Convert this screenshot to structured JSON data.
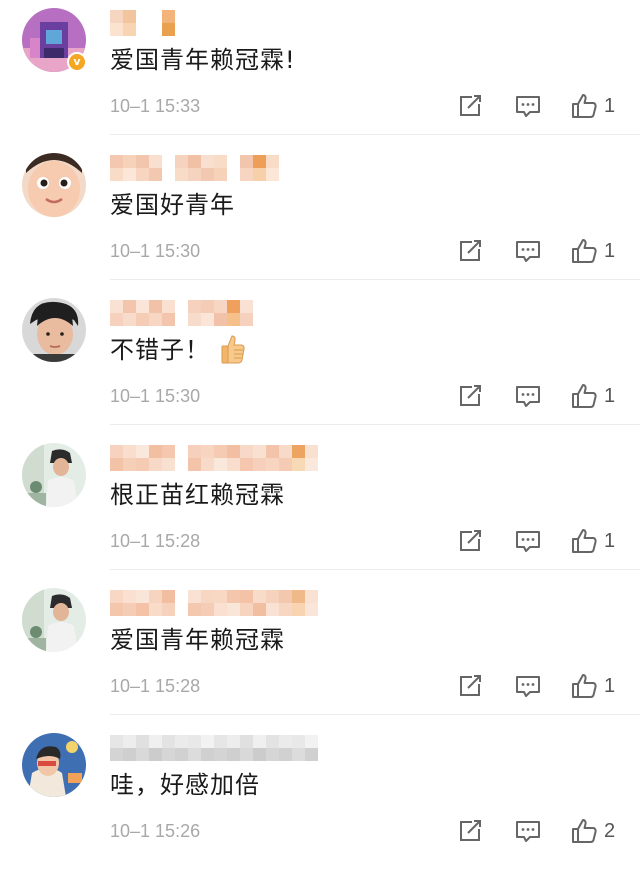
{
  "comments": [
    {
      "text": "爱国青年赖冠霖!",
      "time": "10–1 15:33",
      "likes": "1",
      "verified": true,
      "avatar_icon": "purple-building-avatar",
      "name_colors": [
        "#f6d6c0",
        "#fbe3cf",
        "#f3c59e",
        "#f8d4b3",
        "#ffffff",
        "#f2b47a",
        "#e9a14f"
      ]
    },
    {
      "text": "爱国好青年",
      "time": "10–1 15:30",
      "likes": "1",
      "verified": false,
      "avatar_icon": "cartoon-face-avatar",
      "name_colors": [
        "#f4c8b0",
        "#f9dcc8",
        "#f6d2bb",
        "#fbe6d8",
        "#f2c6ad",
        "#f7d5c0",
        "#f9dfcf",
        "#f3c8b0",
        "#f6d3be",
        "#f8dcc7",
        "#f1c1a6",
        "#ed9f5a",
        "#f7cfa8"
      ]
    },
    {
      "text": "不错子！",
      "time": "10–1 15:30",
      "likes": "1",
      "verified": false,
      "avatar_icon": "boy-portrait-avatar",
      "name_colors": [
        "#f9e2d4",
        "#f6d1bd",
        "#f3c5ad",
        "#f8dccb",
        "#fae5d8",
        "#f5cdb7",
        "#f2c2a8",
        "#f7d6c3",
        "#f9e0d1",
        "#eea05c",
        "#f5c08a"
      ]
    },
    {
      "text": "根正苗红赖冠霖",
      "time": "10–1 15:28",
      "likes": "1",
      "verified": false,
      "avatar_icon": "person-in-cap-avatar",
      "name_colors": [
        "#f7d3bf",
        "#f3c3a8",
        "#f9dece",
        "#f6cfb9",
        "#fbe8dc",
        "#f5cbb4",
        "#f2bfa3",
        "#f8d8c6",
        "#f4c7ae",
        "#f9e1d2",
        "#f6d0ba",
        "#f3c4aa",
        "#f7d5c1",
        "#f8dac8",
        "#eda460",
        "#f8d9b5"
      ]
    },
    {
      "text": "爱国青年赖冠霖",
      "time": "10–1 15:28",
      "likes": "1",
      "verified": false,
      "avatar_icon": "person-in-cap-avatar",
      "name_colors": [
        "#f8d8c5",
        "#f4c6ac",
        "#f9e0d0",
        "#f5ccb5",
        "#fae6d9",
        "#f3c2a7",
        "#f7d4c0",
        "#f8dbc9",
        "#f2bea2",
        "#f6d1bb",
        "#f9e2d3",
        "#f4c8af",
        "#f7d6c2",
        "#f5cdb7",
        "#f0b98a",
        "#f8d4b0"
      ]
    },
    {
      "text": "哇，好感加倍",
      "time": "10–1 15:26",
      "likes": "2",
      "verified": false,
      "avatar_icon": "illustrated-portrait-avatar",
      "name_colors": [
        "#e6e6e6",
        "#d4d4d4",
        "#ededed",
        "#cfcfcf",
        "#e0e0e0",
        "#d9d9d9",
        "#f0f0f0",
        "#cccccc",
        "#e3e3e3",
        "#d6d6d6",
        "#ebebeb",
        "#d1d1d1",
        "#e8e8e8",
        "#dcdcdc",
        "#f2f2f2",
        "#d0d0d0"
      ]
    }
  ],
  "actions": {
    "repost_icon": "share-edit-icon",
    "reply_icon": "comment-bubble-icon",
    "like_icon": "thumbs-up-icon"
  }
}
